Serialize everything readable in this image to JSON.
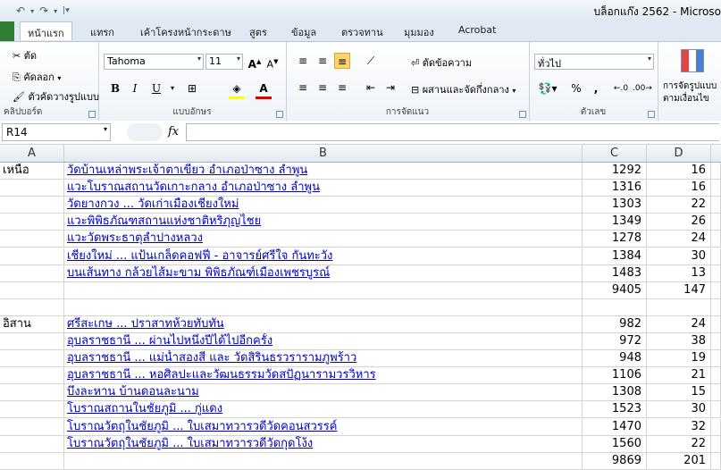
{
  "window": {
    "title": "บล็อกแก๊ง 2562  -  Microso"
  },
  "ribbon_tabs": [
    "หน้าแรก",
    "แทรก",
    "เค้าโครงหน้ากระดาษ",
    "สูตร",
    "ข้อมูล",
    "ตรวจทาน",
    "มุมมอง",
    "Acrobat"
  ],
  "clipboard": {
    "cut": "ตัด",
    "copy": "คัดลอก",
    "format_painter": "ตัวคัดวางรูปแบบ",
    "label": "คลิปบอร์ด"
  },
  "font": {
    "name": "Tahoma",
    "size": "11",
    "label": "แบบอักษร"
  },
  "alignment": {
    "wrap": "ตัดข้อความ",
    "merge": "ผสานและจัดกึ่งกลาง",
    "label": "การจัดแนว"
  },
  "number": {
    "format": "ทั่วไป",
    "label": "ตัวเลข",
    "percent": "%",
    "comma": ","
  },
  "styles": {
    "cond_line1": "การจัดรูปแบบ",
    "cond_line2": "ตามเงื่อนไข"
  },
  "namebox": "R14",
  "fx": "fx",
  "columns": [
    "A",
    "B",
    "C",
    "D"
  ],
  "rows": [
    {
      "a": "เหนือ",
      "b": "วัดบ้านเหล่าพระเจ้าตาเขียว อำเภอป่าซาง ลำพูน",
      "c": "1292",
      "d": "16"
    },
    {
      "a": "",
      "b": "แวะโบราณสถานวัดเกาะกลาง อำเภอป่าซาง ลำพูน",
      "c": "1316",
      "d": "16"
    },
    {
      "a": "",
      "b": "วัดยางกวง ... วัดเก่าเมืองเชียงใหม่",
      "c": "1303",
      "d": "22"
    },
    {
      "a": "",
      "b": "แวะพิพิธภัณฑสถานแห่งชาติหริภุญไชย",
      "c": "1349",
      "d": "26"
    },
    {
      "a": "",
      "b": "แวะวัดพระธาตุลำปางหลวง",
      "c": "1278",
      "d": "24"
    },
    {
      "a": "",
      "b": "เชียงใหม่ ... แป้นเกล็ดคอฟฟี่ - อาจารย์ศรีใจ กันทะวัง",
      "c": "1384",
      "d": "30"
    },
    {
      "a": "",
      "b": "บนเส้นทาง กล้วยไส้มะขาม พิพิธภัณฑ์เมืองเพชรบูรณ์",
      "c": "1483",
      "d": "13"
    },
    {
      "a": "",
      "b": "",
      "c": "9405",
      "d": "147"
    },
    {
      "a": "",
      "b": "",
      "c": "",
      "d": ""
    },
    {
      "a": "อิสาน",
      "b": "ศรีสะเกษ ... ปราสาทห้วยทับทัน",
      "c": "982",
      "d": "24"
    },
    {
      "a": "",
      "b": "อุบลราชธานี ... ผ่านไปหนึ่งปีได้ไปอีกครั้ง",
      "c": "972",
      "d": "38"
    },
    {
      "a": "",
      "b": "อุบลราชธานี ... แม่น้ำสองสี และ วัดสิรินธรวรารามภูพร้าว",
      "c": "948",
      "d": "19"
    },
    {
      "a": "",
      "b": "อุบลราชธานี ... หอศิลปะและวัฒนธรรมวัดสปัฏนารามวรวิหาร",
      "c": "1106",
      "d": "21"
    },
    {
      "a": "",
      "b": "บึงละหาน บ้านดอนละนาม",
      "c": "1308",
      "d": "15"
    },
    {
      "a": "",
      "b": "โบราณสถานในชัยภูมิ ... กู่แดง",
      "c": "1523",
      "d": "30"
    },
    {
      "a": "",
      "b": "โบราณวัตถุในชัยภูมิ ... ใบเสมาทวารวดีวัดคอนสวรรค์",
      "c": "1470",
      "d": "32"
    },
    {
      "a": "",
      "b": "โบราณวัตถุในชัยภูมิ ... ใบเสมาทวารวดีวัดกุดโง้ง",
      "c": "1560",
      "d": "22"
    },
    {
      "a": "",
      "b": "",
      "c": "9869",
      "d": "201"
    }
  ]
}
